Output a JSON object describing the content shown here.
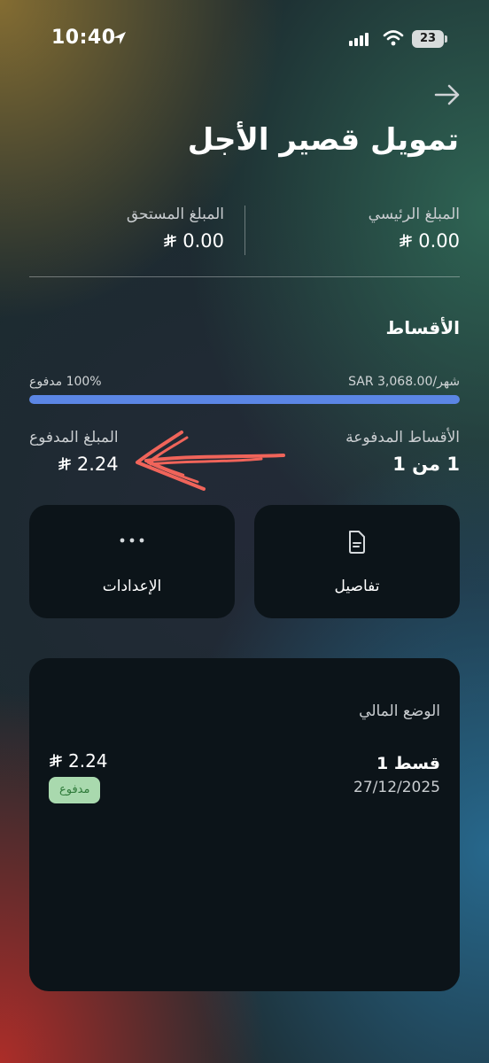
{
  "status_bar": {
    "time": "10:40",
    "battery": "23"
  },
  "header": {
    "title": "تمويل قصير الأجل"
  },
  "summary": {
    "principal_label": "المبلغ الرئيسي",
    "principal_value": "0.00",
    "due_label": "المبلغ المستحق",
    "due_value": "0.00"
  },
  "installments": {
    "title": "الأقساط",
    "monthly_label": "شهر/SAR 3,068.00",
    "paid_percent_label": "100% مدفوع",
    "progress": 1.0,
    "paid_installments_label": "الأقساط المدفوعة",
    "paid_installments_value": "1 من 1",
    "paid_amount_label": "المبلغ المدفوع",
    "paid_amount_value": "2.24"
  },
  "actions": {
    "details_label": "تفاصيل",
    "settings_label": "الإعدادات"
  },
  "financial_status": {
    "title": "الوضع المالي",
    "installment_name": "قسط 1",
    "installment_date": "27/12/2025",
    "installment_amount": "2.24",
    "status_badge": "مدفوع"
  },
  "colors": {
    "progress_fill": "#5b86e5",
    "card_bg": "#0c1419",
    "annotation": "#f0645a",
    "paid_badge_bg": "#a9d9ae",
    "paid_badge_text": "#2f7a3a"
  },
  "icons": {
    "location": "location-arrow-icon",
    "signal": "cellular-signal-icon",
    "wifi": "wifi-icon",
    "back": "arrow-right-icon",
    "currency": "riyal-symbol-icon",
    "details": "document-icon",
    "settings": "more-dots-icon"
  }
}
